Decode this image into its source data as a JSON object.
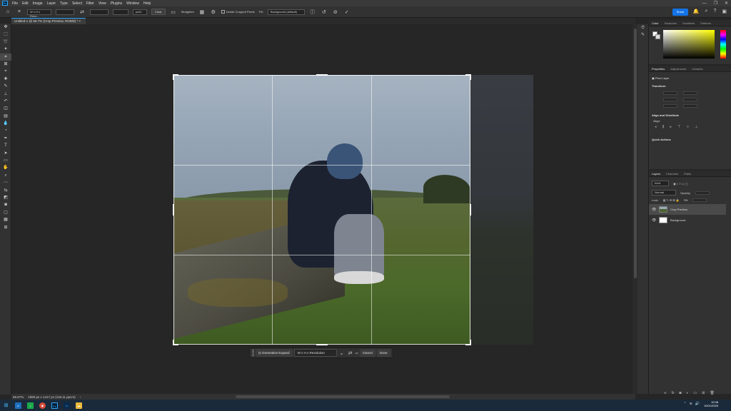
{
  "app": {
    "logo": "Ps",
    "menu": [
      "File",
      "Edit",
      "Image",
      "Layer",
      "Type",
      "Select",
      "Filter",
      "View",
      "Plugins",
      "Window",
      "Help"
    ],
    "window_controls": [
      "—",
      "❐",
      "✕"
    ]
  },
  "options_bar": {
    "ratio_select": "W x H x Reso...",
    "unit_select": "px/in",
    "clear_label": "Clear",
    "straighten_label": "Straighten",
    "delete_cropped_label": "Delete Cropped Pixels",
    "fill_label": "Fill:",
    "fill_select": "Background (default)",
    "share_label": "Share"
  },
  "document": {
    "tab_label": "Untitled-1 @ 66.7% (Crop Preview, RGB/8) *"
  },
  "context_bar": {
    "generative_expand": "Generative Expand",
    "ratio_select": "W x H x Resolution",
    "more": "•••",
    "cancel": "Cancel",
    "done": "Done"
  },
  "status": {
    "zoom": "66.67%",
    "doc_info": "1890 px x 1417 px (118.11 ppcm)"
  },
  "panels": {
    "color_tabs": [
      "Color",
      "Swatches",
      "Gradients",
      "Patterns"
    ],
    "properties_tabs": [
      "Properties",
      "Adjustments",
      "Libraries"
    ],
    "pixel_layer": "Pixel Layer",
    "transform": "Transform",
    "align_distribute": "Align and Distribute",
    "align": "Align:",
    "quick_actions": "Quick Actions",
    "layers_tabs": [
      "Layers",
      "Channels",
      "Paths"
    ],
    "kind": "Kind",
    "blend_mode": "Normal",
    "opacity": "Opacity:",
    "lock": "Lock:",
    "fill": "Fill:",
    "layers": [
      {
        "name": "Crop Preview",
        "selected": true
      },
      {
        "name": "Background",
        "selected": false
      }
    ]
  },
  "taskbar": {
    "time": "10:38",
    "date": "10/01/2025"
  },
  "colors": {
    "accent": "#31a8ff",
    "share": "#1473e6"
  }
}
